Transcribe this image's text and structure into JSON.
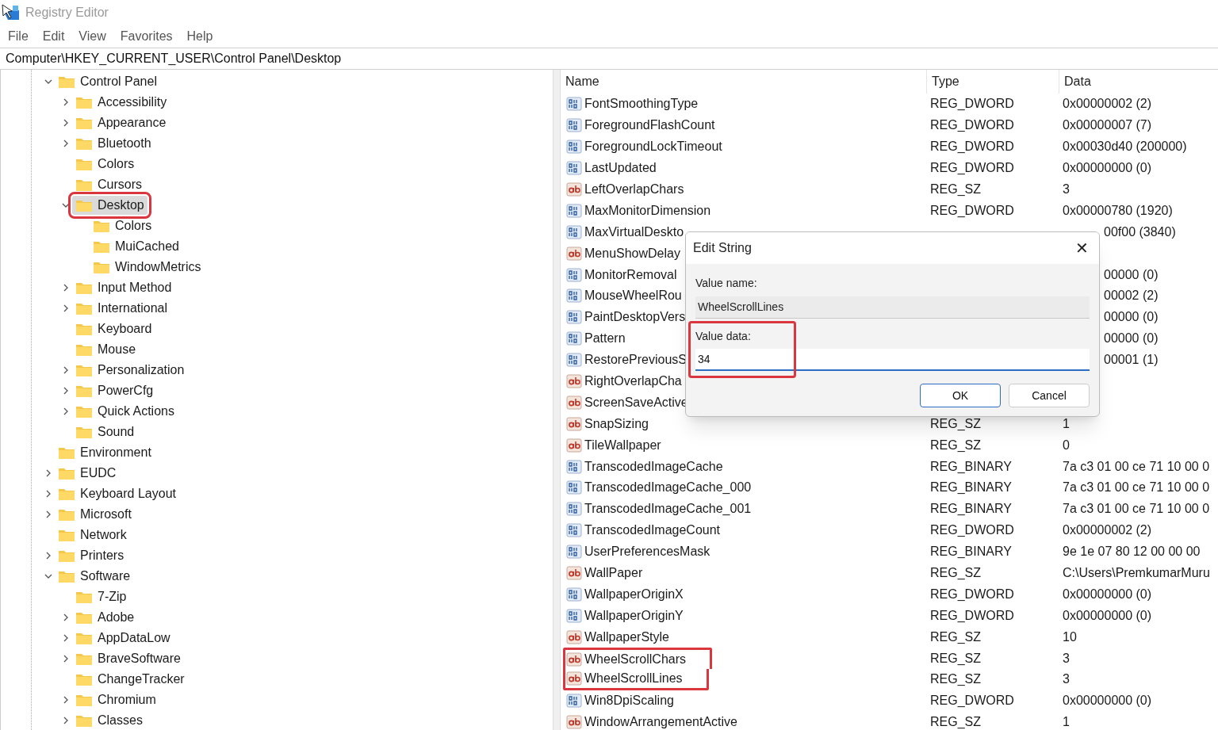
{
  "window": {
    "title": "Registry Editor"
  },
  "menu": [
    "File",
    "Edit",
    "View",
    "Favorites",
    "Help"
  ],
  "address": "Computer\\HKEY_CURRENT_USER\\Control Panel\\Desktop",
  "tree": [
    {
      "label": "Control Panel",
      "expandable": true,
      "expanded": true,
      "selected": false,
      "highlighted": false,
      "children": [
        {
          "label": "Accessibility",
          "expandable": true,
          "expanded": false,
          "selected": false,
          "highlighted": false
        },
        {
          "label": "Appearance",
          "expandable": true,
          "expanded": false,
          "selected": false,
          "highlighted": false
        },
        {
          "label": "Bluetooth",
          "expandable": true,
          "expanded": false,
          "selected": false,
          "highlighted": false
        },
        {
          "label": "Colors",
          "expandable": false,
          "selected": false,
          "highlighted": false
        },
        {
          "label": "Cursors",
          "expandable": false,
          "selected": false,
          "highlighted": false
        },
        {
          "label": "Desktop",
          "expandable": true,
          "expanded": true,
          "selected": true,
          "highlighted": true,
          "children": [
            {
              "label": "Colors",
              "expandable": false,
              "selected": false,
              "highlighted": false
            },
            {
              "label": "MuiCached",
              "expandable": false,
              "selected": false,
              "highlighted": false
            },
            {
              "label": "WindowMetrics",
              "expandable": false,
              "selected": false,
              "highlighted": false
            }
          ]
        },
        {
          "label": "Input Method",
          "expandable": true,
          "expanded": false,
          "selected": false,
          "highlighted": false
        },
        {
          "label": "International",
          "expandable": true,
          "expanded": false,
          "selected": false,
          "highlighted": false
        },
        {
          "label": "Keyboard",
          "expandable": false,
          "selected": false,
          "highlighted": false
        },
        {
          "label": "Mouse",
          "expandable": false,
          "selected": false,
          "highlighted": false
        },
        {
          "label": "Personalization",
          "expandable": true,
          "expanded": false,
          "selected": false,
          "highlighted": false
        },
        {
          "label": "PowerCfg",
          "expandable": true,
          "expanded": false,
          "selected": false,
          "highlighted": false
        },
        {
          "label": "Quick Actions",
          "expandable": true,
          "expanded": false,
          "selected": false,
          "highlighted": false
        },
        {
          "label": "Sound",
          "expandable": false,
          "selected": false,
          "highlighted": false
        }
      ]
    },
    {
      "label": "Environment",
      "expandable": false,
      "selected": false,
      "highlighted": false
    },
    {
      "label": "EUDC",
      "expandable": true,
      "expanded": false,
      "selected": false,
      "highlighted": false
    },
    {
      "label": "Keyboard Layout",
      "expandable": true,
      "expanded": false,
      "selected": false,
      "highlighted": false
    },
    {
      "label": "Microsoft",
      "expandable": true,
      "expanded": false,
      "selected": false,
      "highlighted": false
    },
    {
      "label": "Network",
      "expandable": false,
      "selected": false,
      "highlighted": false
    },
    {
      "label": "Printers",
      "expandable": true,
      "expanded": false,
      "selected": false,
      "highlighted": false
    },
    {
      "label": "Software",
      "expandable": true,
      "expanded": true,
      "selected": false,
      "highlighted": false,
      "children": [
        {
          "label": "7-Zip",
          "expandable": false,
          "selected": false,
          "highlighted": false
        },
        {
          "label": "Adobe",
          "expandable": true,
          "expanded": false,
          "selected": false,
          "highlighted": false
        },
        {
          "label": "AppDataLow",
          "expandable": true,
          "expanded": false,
          "selected": false,
          "highlighted": false
        },
        {
          "label": "BraveSoftware",
          "expandable": true,
          "expanded": false,
          "selected": false,
          "highlighted": false
        },
        {
          "label": "ChangeTracker",
          "expandable": false,
          "selected": false,
          "highlighted": false
        },
        {
          "label": "Chromium",
          "expandable": true,
          "expanded": false,
          "selected": false,
          "highlighted": false
        },
        {
          "label": "Classes",
          "expandable": true,
          "expanded": false,
          "selected": false,
          "highlighted": false
        }
      ]
    }
  ],
  "table": {
    "columns": [
      "Name",
      "Type",
      "Data"
    ],
    "rows": [
      {
        "kind": "binary",
        "name": "FontSmoothingType",
        "type": "REG_DWORD",
        "data": "0x00000002 (2)",
        "highlighted": false
      },
      {
        "kind": "binary",
        "name": "ForegroundFlashCount",
        "type": "REG_DWORD",
        "data": "0x00000007 (7)",
        "highlighted": false
      },
      {
        "kind": "binary",
        "name": "ForegroundLockTimeout",
        "type": "REG_DWORD",
        "data": "0x00030d40 (200000)",
        "highlighted": false
      },
      {
        "kind": "binary",
        "name": "LastUpdated",
        "type": "REG_DWORD",
        "data": "0x00000000 (0)",
        "highlighted": false
      },
      {
        "kind": "string",
        "name": "LeftOverlapChars",
        "type": "REG_SZ",
        "data": "3",
        "highlighted": false
      },
      {
        "kind": "binary",
        "name": "MaxMonitorDimension",
        "type": "REG_DWORD",
        "data": "0x00000780 (1920)",
        "highlighted": false
      },
      {
        "kind": "binary",
        "name": "MaxVirtualDeskto",
        "data_fragment": "00f00 (3840)",
        "highlighted": false
      },
      {
        "kind": "string",
        "name": "MenuShowDelay",
        "highlighted": false
      },
      {
        "kind": "binary",
        "name": "MonitorRemoval",
        "data_fragment": "00000 (0)",
        "highlighted": false
      },
      {
        "kind": "binary",
        "name": "MouseWheelRou",
        "data_fragment": "00002 (2)",
        "highlighted": false
      },
      {
        "kind": "binary",
        "name": "PaintDesktopVers",
        "data_fragment": "00000 (0)",
        "highlighted": false
      },
      {
        "kind": "binary",
        "name": "Pattern",
        "data_fragment": "00000 (0)",
        "highlighted": false
      },
      {
        "kind": "binary",
        "name": "RestorePreviousS",
        "data_fragment": "00001 (1)",
        "highlighted": false
      },
      {
        "kind": "string",
        "name": "RightOverlapCha",
        "highlighted": false
      },
      {
        "kind": "string",
        "name": "ScreenSaveActive",
        "highlighted": false
      },
      {
        "kind": "string",
        "name": "SnapSizing",
        "type": "REG_SZ",
        "data": "1",
        "highlighted": false
      },
      {
        "kind": "string",
        "name": "TileWallpaper",
        "type": "REG_SZ",
        "data": "0",
        "highlighted": false
      },
      {
        "kind": "binary",
        "name": "TranscodedImageCache",
        "type": "REG_BINARY",
        "data": "7a c3 01 00 ce 71 10 00 0",
        "highlighted": false
      },
      {
        "kind": "binary",
        "name": "TranscodedImageCache_000",
        "type": "REG_BINARY",
        "data": "7a c3 01 00 ce 71 10 00 0",
        "highlighted": false
      },
      {
        "kind": "binary",
        "name": "TranscodedImageCache_001",
        "type": "REG_BINARY",
        "data": "7a c3 01 00 ce 71 10 00 0",
        "highlighted": false
      },
      {
        "kind": "binary",
        "name": "TranscodedImageCount",
        "type": "REG_DWORD",
        "data": "0x00000002 (2)",
        "highlighted": false
      },
      {
        "kind": "binary",
        "name": "UserPreferencesMask",
        "type": "REG_BINARY",
        "data": "9e 1e 07 80 12 00 00 00",
        "highlighted": false
      },
      {
        "kind": "string",
        "name": "WallPaper",
        "type": "REG_SZ",
        "data": "C:\\Users\\PremkumarMuru",
        "highlighted": false
      },
      {
        "kind": "binary",
        "name": "WallpaperOriginX",
        "type": "REG_DWORD",
        "data": "0x00000000 (0)",
        "highlighted": false
      },
      {
        "kind": "binary",
        "name": "WallpaperOriginY",
        "type": "REG_DWORD",
        "data": "0x00000000 (0)",
        "highlighted": false
      },
      {
        "kind": "string",
        "name": "WallpaperStyle",
        "type": "REG_SZ",
        "data": "10",
        "highlighted": false
      },
      {
        "kind": "string",
        "name": "WheelScrollChars",
        "type": "REG_SZ",
        "data": "3",
        "highlighted": true
      },
      {
        "kind": "string",
        "name": "WheelScrollLines",
        "type": "REG_SZ",
        "data": "3",
        "highlighted": true
      },
      {
        "kind": "binary",
        "name": "Win8DpiScaling",
        "type": "REG_DWORD",
        "data": "0x00000000 (0)",
        "highlighted": false
      },
      {
        "kind": "string",
        "name": "WindowArrangementActive",
        "type": "REG_SZ",
        "data": "1",
        "highlighted": false
      }
    ]
  },
  "dialog": {
    "title": "Edit String",
    "close": "✕",
    "value_name_label": "Value name:",
    "value_name": "WheelScrollLines",
    "value_data_label": "Value data:",
    "value_data": "34",
    "value_data_highlighted": true,
    "buttons": [
      {
        "label": "OK",
        "default": true
      },
      {
        "label": "Cancel",
        "default": false
      }
    ]
  }
}
